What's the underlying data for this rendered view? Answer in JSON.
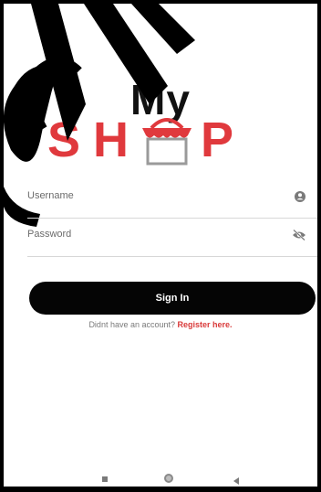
{
  "logo": {
    "line1": "My",
    "line2": [
      "S",
      "H",
      "P"
    ]
  },
  "form": {
    "username_placeholder": "Username",
    "password_placeholder": "Password",
    "signin_label": "Sign In"
  },
  "footer": {
    "prompt": "Didnt have an account?",
    "register_label": "Register here."
  },
  "icons": {
    "username": "person-circle-icon",
    "password": "eye-off-icon",
    "nav_recent": "square-icon",
    "nav_home": "circle-icon",
    "nav_back": "back-triangle-icon"
  },
  "colors": {
    "brand_red": "#e0393d",
    "button_black": "#050505",
    "link_red": "#d93a3a"
  }
}
